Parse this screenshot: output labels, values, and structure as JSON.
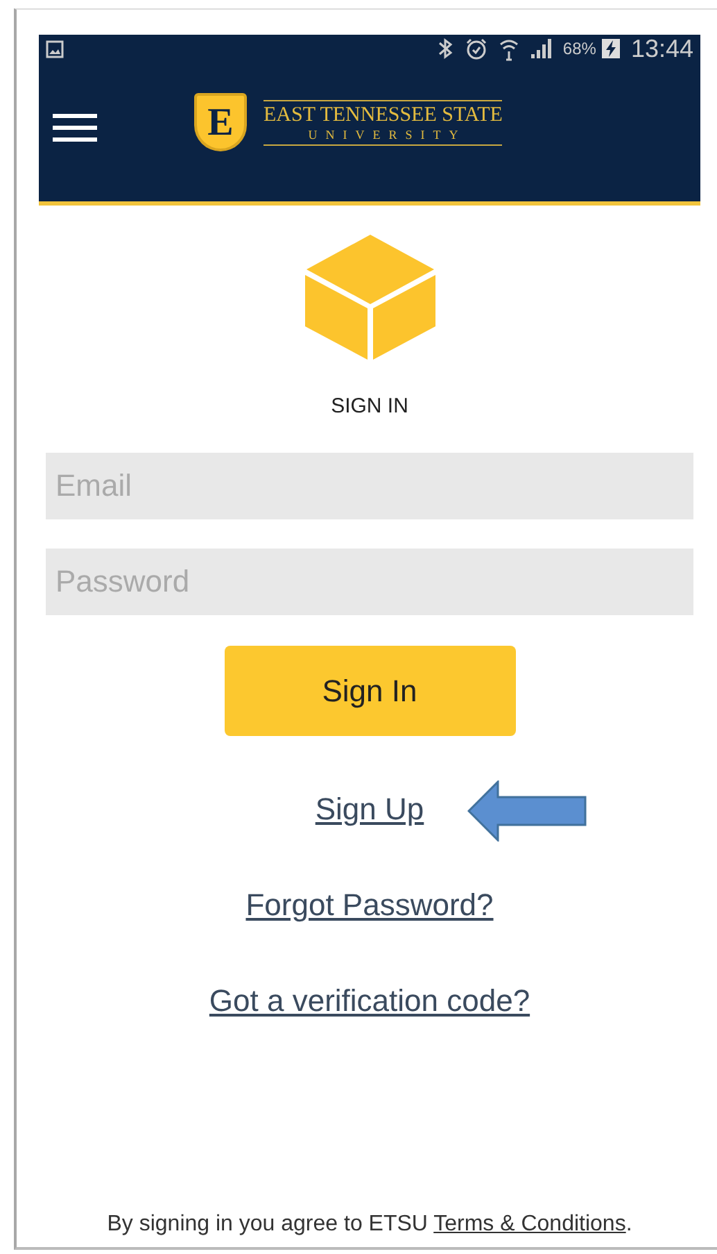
{
  "status_bar": {
    "battery": "68%",
    "time": "13:44"
  },
  "header": {
    "logo_letter": "E",
    "logo_title": "EAST TENNESSEE STATE",
    "logo_subtitle": "UNIVERSITY"
  },
  "heading": "SIGN IN",
  "fields": [
    {
      "placeholder": "Email"
    },
    {
      "placeholder": "Password"
    }
  ],
  "button": "Sign In",
  "links": [
    "Sign Up",
    "Forgot Password?",
    "Got a verification code?"
  ],
  "footer": {
    "text": "By signing in you agree to ETSU",
    "link": "Terms & Conditions",
    "end": "."
  },
  "annotation": {
    "kind": "arrow"
  }
}
